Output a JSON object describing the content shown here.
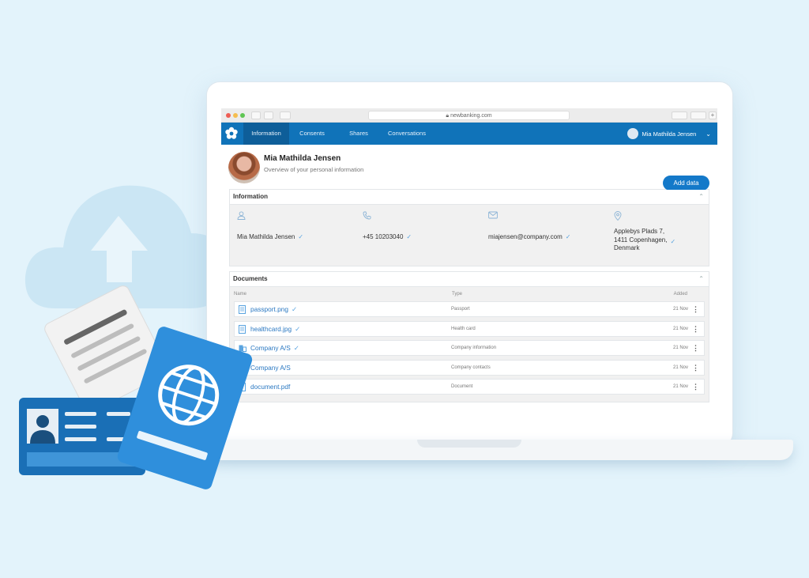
{
  "browser": {
    "url": "newbanking.com",
    "traffic_light_colors": [
      "#ee5e55",
      "#f5bd4f",
      "#5fc553"
    ]
  },
  "nav": {
    "tabs": [
      {
        "label": "Information",
        "active": true
      },
      {
        "label": "Consents",
        "active": false
      },
      {
        "label": "Shares",
        "active": false
      },
      {
        "label": "Conversations",
        "active": false
      }
    ],
    "user_name": "Mia Mathilda Jensen",
    "accent": "#1073b9"
  },
  "profile": {
    "name": "Mia Mathilda Jensen",
    "subtitle": "Overview of your personal information",
    "add_button": "Add data"
  },
  "information": {
    "title": "Information",
    "items": [
      {
        "icon": "user-icon",
        "value": "Mia Mathilda Jensen"
      },
      {
        "icon": "phone-icon",
        "value": "+45 10203040"
      },
      {
        "icon": "mail-icon",
        "value": "miajensen@company.com"
      },
      {
        "icon": "location-pin-icon",
        "value_lines": [
          "Applebys Plads 7,",
          "1411 Copenhagen,",
          "Denmark"
        ]
      }
    ]
  },
  "documents": {
    "title": "Documents",
    "columns": [
      "Name",
      "Type",
      "Added"
    ],
    "rows": [
      {
        "icon": "image-file-icon",
        "name": "passport.png",
        "verified": true,
        "type": "Passport",
        "added": "21 Nov"
      },
      {
        "icon": "image-file-icon",
        "name": "healthcard.jpg",
        "verified": true,
        "type": "Health card",
        "added": "21 Nov"
      },
      {
        "icon": "building-icon",
        "name": "Company A/S",
        "verified": true,
        "type": "Company information",
        "added": "21 Nov"
      },
      {
        "icon": "contacts-icon",
        "name": "Company A/S",
        "verified": false,
        "type": "Company contacts",
        "added": "21 Nov"
      },
      {
        "icon": "document-icon",
        "name": "document.pdf",
        "verified": false,
        "type": "Document",
        "added": "21 Nov"
      }
    ]
  }
}
